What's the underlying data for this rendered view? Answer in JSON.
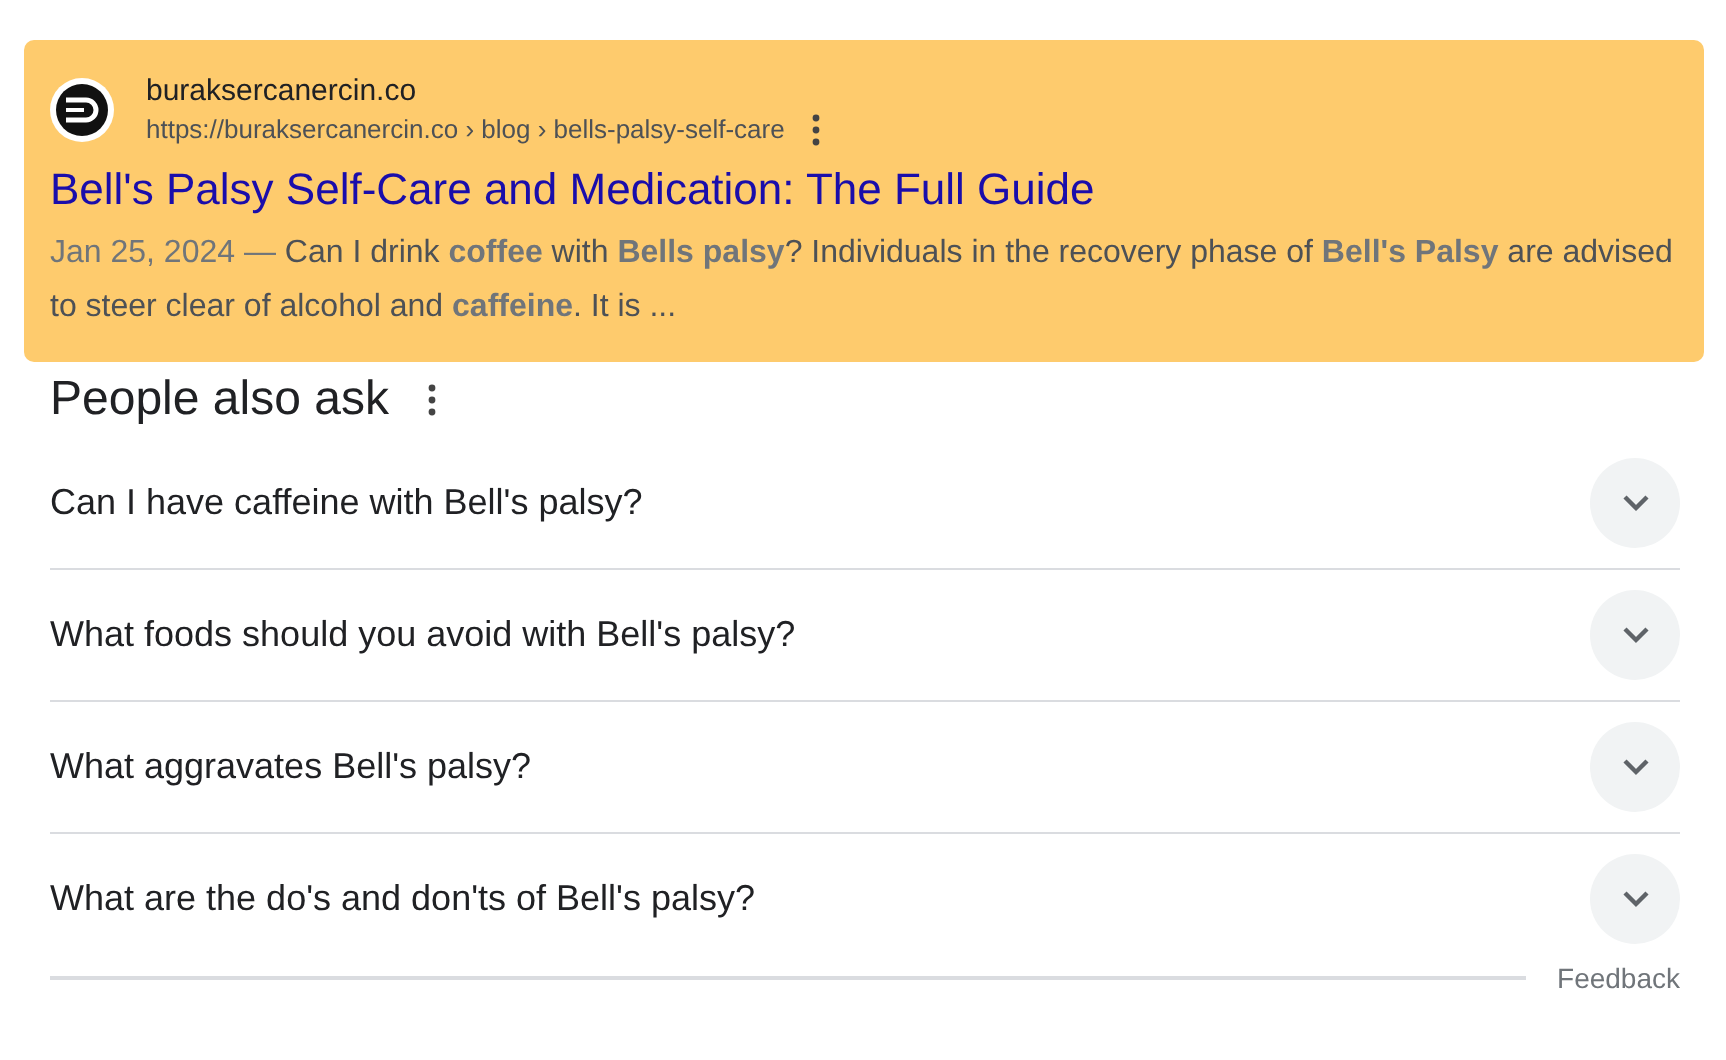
{
  "result": {
    "site_name": "buraksercanercin.co",
    "url": "https://buraksercanercin.co › blog › bells-palsy-self-care",
    "title": "Bell's Palsy Self-Care and Medication: The Full Guide",
    "date": "Jan 25, 2024 —",
    "snippet": "Can I drink **coffee** with **Bells palsy**? Individuals in the recovery phase of **Bell's Palsy** are advised to steer clear of alcohol and **caffeine**. It is ...",
    "highlighted": true
  },
  "people_also_ask": {
    "heading": "People also ask",
    "questions": [
      {
        "text": "Can I have caffeine with Bell's palsy?",
        "expanded": false
      },
      {
        "text": "What foods should you avoid with Bell's palsy?",
        "expanded": false
      },
      {
        "text": "What aggravates Bell's palsy?",
        "expanded": false
      },
      {
        "text": "What are the do's and don'ts of Bell's palsy?",
        "expanded": false
      }
    ],
    "feedback": "Feedback"
  }
}
